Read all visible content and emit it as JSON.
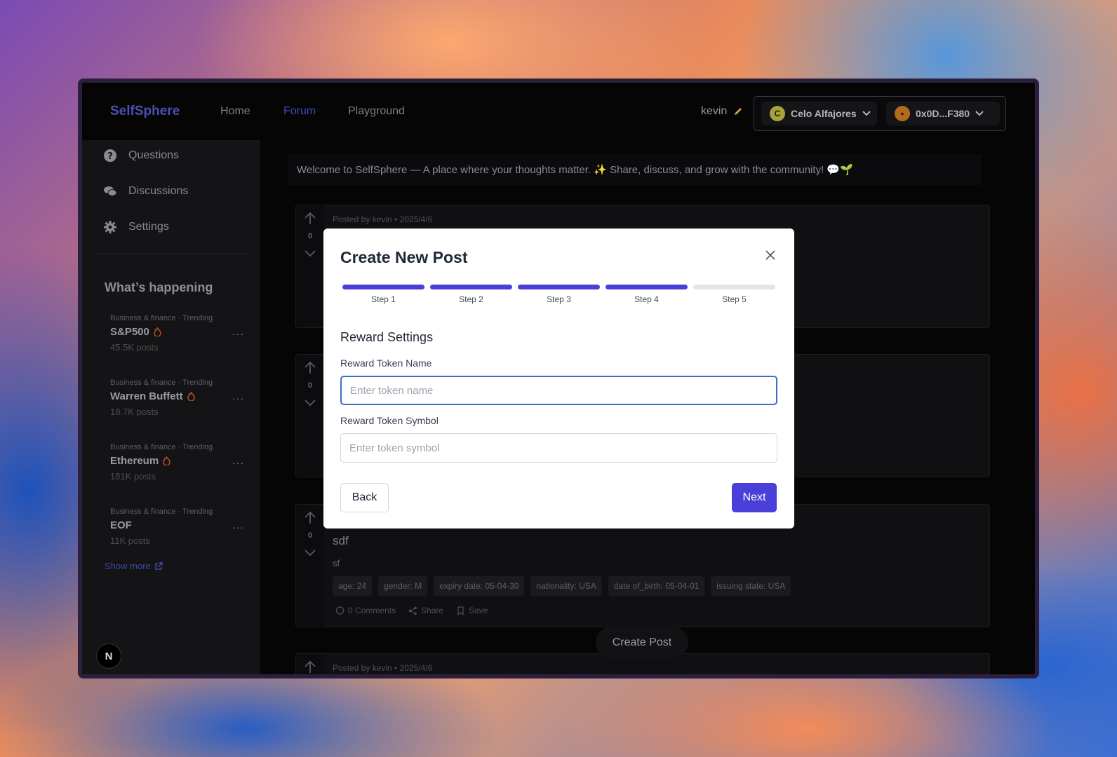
{
  "navbar": {
    "brand": "SelfSphere",
    "links": [
      "Home",
      "Forum",
      "Playground"
    ],
    "active_link": "Forum",
    "user": "kevin",
    "chain_label": "Celo Alfajores",
    "chain_icon": "C",
    "account_label": "0x0D...F380"
  },
  "sidebar": {
    "items": [
      {
        "label": "Questions",
        "icon": "question-circle-icon"
      },
      {
        "label": "Discussions",
        "icon": "chat-bubbles-icon"
      },
      {
        "label": "Settings",
        "icon": "gear-icon"
      }
    ],
    "happening_title": "What’s happening",
    "trends": [
      {
        "category": "Business & finance · Trending",
        "title": "S&P500",
        "posts": "45.5K posts",
        "fire": true
      },
      {
        "category": "Business & finance · Trending",
        "title": "Warren Buffett",
        "posts": "18.7K posts",
        "fire": true
      },
      {
        "category": "Business & finance · Trending",
        "title": "Ethereum",
        "posts": "181K posts",
        "fire": true
      },
      {
        "category": "Business & finance · Trending",
        "title": "EOF",
        "posts": "11K posts",
        "fire": false
      }
    ],
    "trend_more": "···",
    "show_more": "Show more",
    "logo_letter": "N"
  },
  "main": {
    "welcome": "Welcome to SelfSphere — A place where your thoughts matter. ✨ Share, discuss, and grow with the community! 💬🌱",
    "posts": [
      {
        "meta": "Posted by kevin  • 2025/4/6",
        "votes": "0"
      },
      {
        "votes": "0"
      },
      {
        "votes": "0",
        "title": "sdf",
        "body": "sf",
        "tags": [
          "age: 24",
          "gender: M",
          "expiry date: 05-04-30",
          "nationality: USA",
          "date of_birth: 05-04-01",
          "issuing state: USA"
        ],
        "comments": "0 Comments",
        "share": "Share",
        "save": "Save"
      },
      {
        "meta": "Posted by kevin  • 2025/4/6"
      }
    ],
    "create_post": "Create Post"
  },
  "modal": {
    "title": "Create New Post",
    "steps": [
      "Step 1",
      "Step 2",
      "Step 3",
      "Step 4",
      "Step 5"
    ],
    "current_step": 4,
    "section": "Reward Settings",
    "token_name_label": "Reward Token Name",
    "token_name_placeholder": "Enter token name",
    "token_symbol_label": "Reward Token Symbol",
    "token_symbol_placeholder": "Enter token symbol",
    "back": "Back",
    "next": "Next"
  },
  "colors": {
    "accent": "#4a3fd9",
    "focus": "#3b6fc4",
    "brand": "#4b4fb0"
  }
}
